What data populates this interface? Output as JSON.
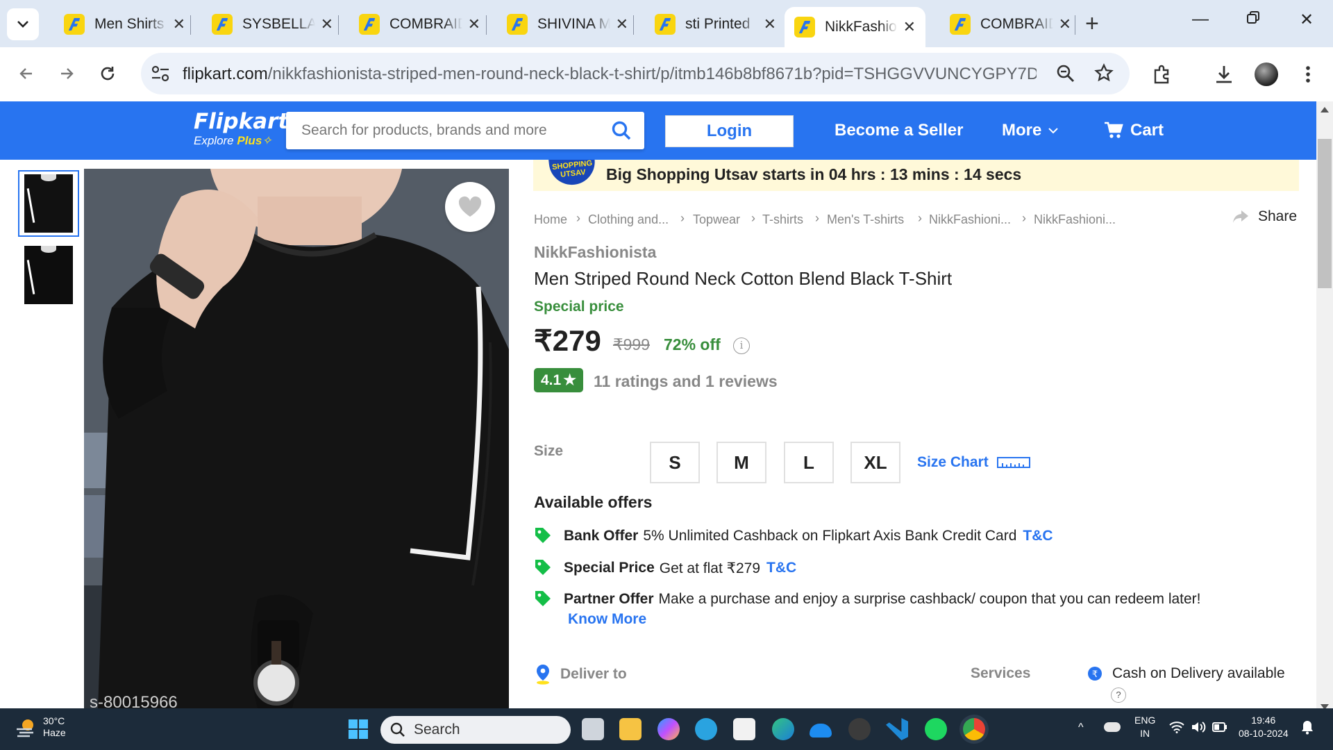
{
  "browser": {
    "tabs": [
      {
        "title": "Men Shirts"
      },
      {
        "title": "SYSBELLA"
      },
      {
        "title": "COMBRAIDED"
      },
      {
        "title": "SHIVINA M"
      },
      {
        "title": "sti Printed"
      },
      {
        "title": "NikkFashionista",
        "active": true
      },
      {
        "title": "COMBRAIDED"
      }
    ],
    "url_host": "flipkart.com",
    "url_path": "/nikkfashionista-striped-men-round-neck-black-t-shirt/p/itmb146b8bf8671b?pid=TSHGGVVUNCYGPY7D..."
  },
  "header": {
    "logo": "Flipkart",
    "logo_sub_prefix": "Explore",
    "logo_sub_plus": "Plus",
    "search_placeholder": "Search for products, brands and more",
    "login": "Login",
    "become_seller": "Become a Seller",
    "more": "More",
    "cart": "Cart"
  },
  "banner": {
    "badge": "SHOPPING UTSAV",
    "text": "Big Shopping Utsav starts in 04 hrs : 13 mins : 14 secs"
  },
  "breadcrumbs": [
    "Home",
    "Clothing and...",
    "Topwear",
    "T-shirts",
    "Men's T-shirts",
    "NikkFashioni...",
    "NikkFashioni..."
  ],
  "share": "Share",
  "product": {
    "brand": "NikkFashionista",
    "title": "Men Striped Round Neck Cotton Blend Black T-Shirt",
    "special_price_label": "Special price",
    "price": "₹279",
    "mrp": "₹999",
    "discount": "72% off",
    "rating": "4.1",
    "rating_text": "11 ratings and 1 reviews",
    "image_code": "s-80015966"
  },
  "size": {
    "label": "Size",
    "options": [
      "S",
      "M",
      "L",
      "XL"
    ],
    "chart_link": "Size Chart"
  },
  "offers": {
    "heading": "Available offers",
    "items": [
      {
        "title": "Bank Offer",
        "text": "5% Unlimited Cashback on Flipkart Axis Bank Credit Card",
        "link": "T&C"
      },
      {
        "title": "Special Price",
        "text": "Get at flat ₹279",
        "link": "T&C"
      },
      {
        "title": "Partner Offer",
        "text": "Make a purchase and enjoy a surprise cashback/ coupon that you can redeem later!",
        "link": ""
      }
    ],
    "know_more": "Know More"
  },
  "delivery": {
    "deliver_to": "Deliver to",
    "services": "Services",
    "cod": "Cash on Delivery available"
  },
  "taskbar": {
    "temp": "30°C",
    "weather": "Haze",
    "search": "Search",
    "lang1": "ENG",
    "lang2": "IN",
    "time": "19:46",
    "date": "08-10-2024"
  }
}
